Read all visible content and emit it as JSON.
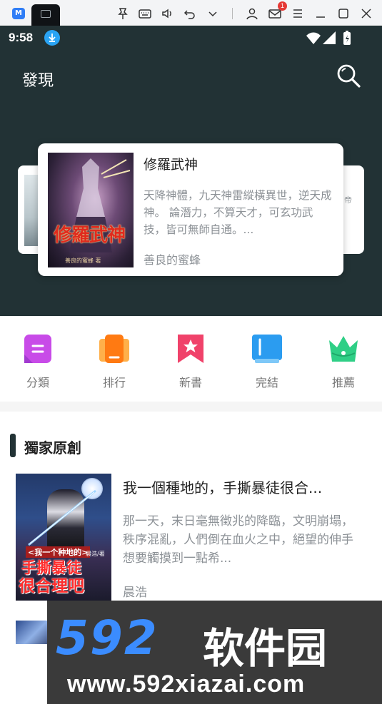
{
  "emulator": {
    "logo_text": "M",
    "badge_count": "1"
  },
  "status_bar": {
    "time": "9:58"
  },
  "header": {
    "title": "發現"
  },
  "carousel": {
    "main": {
      "title": "修羅武神",
      "cover_title": "修羅武神",
      "cover_author": "善良的蜜蜂 著",
      "description": "天降神體，九天神雷縱橫異世，逆天成神。 論潛力，不算天才，可玄功武技，皆可無師自通。...",
      "author": "善良的蜜蜂"
    },
    "right_peek_text": "帝"
  },
  "categories": [
    {
      "label": "分類",
      "icon": "category-icon",
      "color": "#c84be8"
    },
    {
      "label": "排行",
      "icon": "ranking-icon",
      "color": "#ff8a1f"
    },
    {
      "label": "新書",
      "icon": "new-book-icon",
      "color": "#f0426a"
    },
    {
      "label": "完結",
      "icon": "completed-icon",
      "color": "#2b9cf0"
    },
    {
      "label": "推薦",
      "icon": "recommend-crown-icon",
      "color": "#2fcf86"
    }
  ],
  "section": {
    "title": "獨家原創",
    "books": [
      {
        "title": "我一個種地的，手撕暴徒很合...",
        "description": "那一天，末日毫無徵兆的降臨，文明崩塌，秩序混亂，人們倒在血火之中，絕望的伸手想要觸摸到一點希...",
        "author": "晨浩",
        "cover_line1": "<我一个种地的>",
        "cover_line2": "手撕暴徒",
        "cover_line3": "很合理吧",
        "cover_author": "晨浩/著"
      }
    ]
  },
  "watermark": {
    "logo": "592",
    "name": "软件园",
    "url": "www.592xiazai.com"
  },
  "colors": {
    "header_bg": "#223235",
    "accent": "#223235",
    "watermark_blue": "#3b8cff"
  }
}
